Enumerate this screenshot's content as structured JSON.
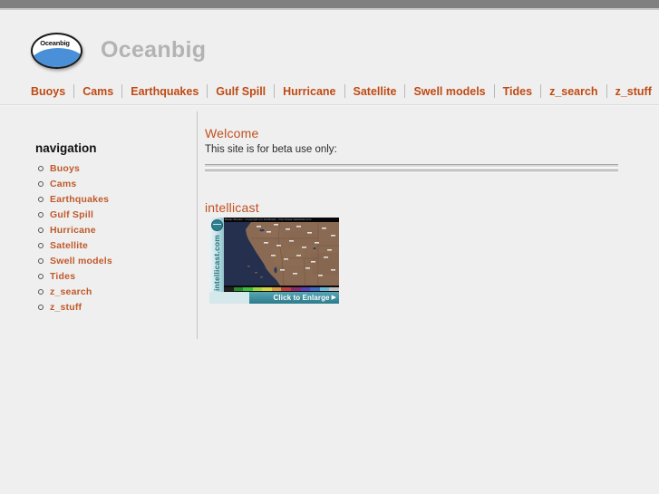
{
  "window": {
    "chrome_bar": ""
  },
  "header": {
    "logo_word": "Oceanbig",
    "site_name": "Oceanbig"
  },
  "primary_nav": {
    "items": [
      {
        "label": "Buoys"
      },
      {
        "label": "Cams"
      },
      {
        "label": "Earthquakes"
      },
      {
        "label": "Gulf Spill"
      },
      {
        "label": "Hurricane"
      },
      {
        "label": "Satellite"
      },
      {
        "label": "Swell models"
      },
      {
        "label": "Tides"
      },
      {
        "label": "z_search"
      },
      {
        "label": "z_stuff"
      }
    ]
  },
  "sidebar": {
    "title": "navigation",
    "items": [
      {
        "label": "Buoys"
      },
      {
        "label": "Cams"
      },
      {
        "label": "Earthquakes"
      },
      {
        "label": "Gulf Spill"
      },
      {
        "label": "Hurricane"
      },
      {
        "label": "Satellite"
      },
      {
        "label": "Swell models"
      },
      {
        "label": "Tides"
      },
      {
        "label": "z_search"
      },
      {
        "label": "z_stuff"
      }
    ]
  },
  "main": {
    "welcome_title": "Welcome",
    "welcome_text": "This site is for beta use only:",
    "intellicast_title": "intellicast",
    "thumbnail": {
      "brand_text": "intellicast.com",
      "top_strip_text": "Radar Mosaic - Copyright (C) Intellicast - http://www.intellicast.com",
      "enlarge_label": "Click to Enlarge",
      "enlarge_arrow": "▶",
      "legend_colors": [
        "#1f1f1f",
        "#2b8a2b",
        "#3fbf3f",
        "#9fd63f",
        "#d6d63f",
        "#d69b3f",
        "#bf3f3f",
        "#8a2b6b",
        "#5a3fbf",
        "#3f6bbf",
        "#6fb7d6",
        "#bfbfbf"
      ]
    }
  },
  "colors": {
    "link": "#bf4a13",
    "sidebar_link": "#c05a2b",
    "heading": "#c1501e",
    "page_bg": "#efefef",
    "brand_gray": "#b3b3b3",
    "logo_blue": "#4a90d9",
    "thumb_teal": "#2a7b8a"
  }
}
